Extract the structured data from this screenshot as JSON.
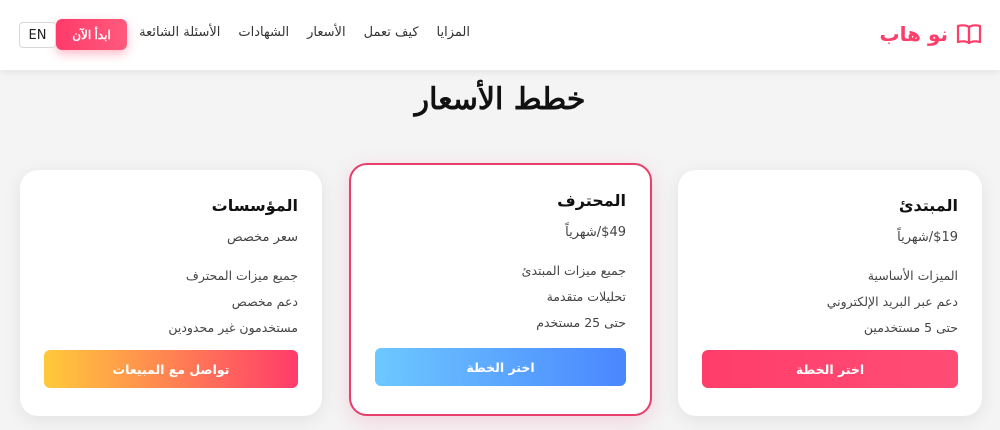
{
  "brand": {
    "name": "نو هاب",
    "icon": "book-icon",
    "color": "#ff3d68"
  },
  "nav": {
    "items": [
      "المزايا",
      "كيف تعمل",
      "الأسعار",
      "الشهادات",
      "الأسئلة الشائعة"
    ],
    "cta_label": "ابدأ الآن",
    "lang_label": "EN"
  },
  "pricing": {
    "title": "خطط الأسعار",
    "plans": [
      {
        "name": "المبتدئ",
        "price": "$19/شهرياً",
        "features": [
          "الميزات الأساسية",
          "دعم عبر البريد الإلكتروني",
          "حتى 5 مستخدمين"
        ],
        "button_label": "اختر الخطة"
      },
      {
        "name": "المحترف",
        "price": "$49/شهرياً",
        "features": [
          "جميع ميزات المبتدئ",
          "تحليلات متقدمة",
          "حتى 25 مستخدم"
        ],
        "button_label": "اختر الخطة",
        "featured": true
      },
      {
        "name": "المؤسسات",
        "price": "سعر مخصص",
        "features": [
          "جميع ميزات المحترف",
          "دعم مخصص",
          "مستخدمون غير محدودين"
        ],
        "button_label": "تواصل مع المبيعات"
      }
    ]
  },
  "colors": {
    "accent": "#ff3d6a",
    "pro_gradient": [
      "#4a86ff",
      "#6dc8ff"
    ],
    "enterprise_gradient": [
      "#ff3b6b",
      "#ffca3a"
    ],
    "featured_border": "#e83e6c"
  }
}
